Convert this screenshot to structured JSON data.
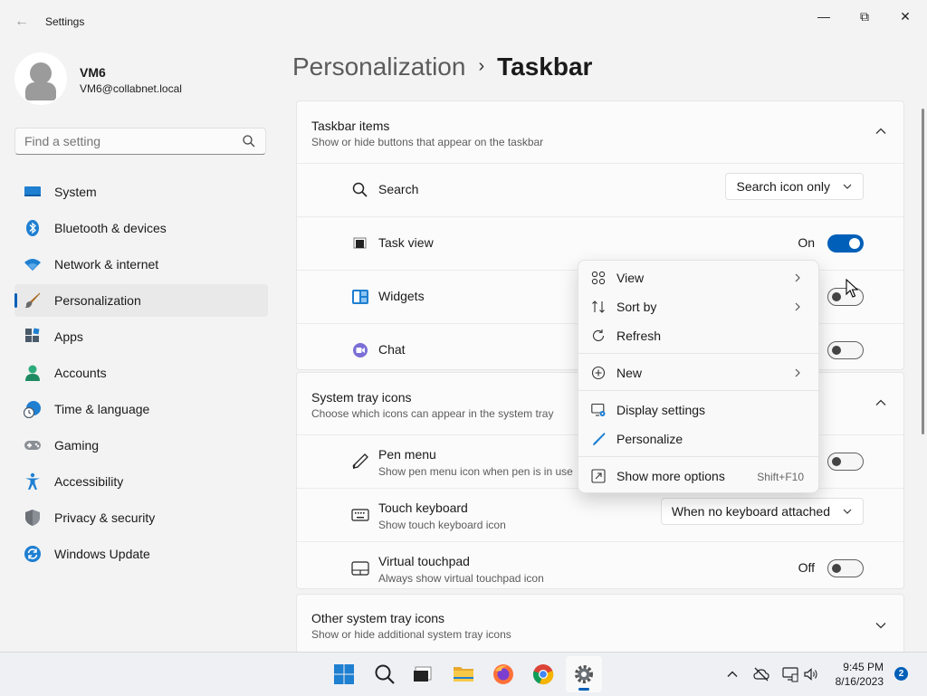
{
  "window": {
    "title": "Settings",
    "minimize_glyph": "—",
    "maximize_glyph": "⧉",
    "close_glyph": "✕",
    "back_glyph": "←"
  },
  "profile": {
    "name": "VM6",
    "email": "VM6@collabnet.local"
  },
  "search": {
    "placeholder": "Find a setting"
  },
  "nav": {
    "items": [
      {
        "label": "System",
        "icon": "monitor-icon"
      },
      {
        "label": "Bluetooth & devices",
        "icon": "bluetooth-icon"
      },
      {
        "label": "Network & internet",
        "icon": "wifi-icon"
      },
      {
        "label": "Personalization",
        "icon": "brush-icon",
        "active": true
      },
      {
        "label": "Apps",
        "icon": "apps-icon"
      },
      {
        "label": "Accounts",
        "icon": "person-icon"
      },
      {
        "label": "Time & language",
        "icon": "globe-clock-icon"
      },
      {
        "label": "Gaming",
        "icon": "gamepad-icon"
      },
      {
        "label": "Accessibility",
        "icon": "accessibility-icon"
      },
      {
        "label": "Privacy & security",
        "icon": "shield-icon"
      },
      {
        "label": "Windows Update",
        "icon": "update-icon"
      }
    ]
  },
  "breadcrumb": {
    "parent": "Personalization",
    "separator": "›",
    "current": "Taskbar"
  },
  "taskbar_items": {
    "title": "Taskbar items",
    "subtitle": "Show or hide buttons that appear on the taskbar",
    "rows": {
      "search": {
        "label": "Search",
        "value": "Search icon only"
      },
      "task_view": {
        "label": "Task view",
        "state": "On"
      },
      "widgets": {
        "label": "Widgets"
      },
      "chat": {
        "label": "Chat"
      }
    }
  },
  "system_tray": {
    "title": "System tray icons",
    "subtitle": "Choose which icons can appear in the system tray",
    "rows": {
      "pen_menu": {
        "label": "Pen menu",
        "sub": "Show pen menu icon when pen is in use"
      },
      "touch_keyboard": {
        "label": "Touch keyboard",
        "sub": "Show touch keyboard icon",
        "value": "When no keyboard attached"
      },
      "virtual_touchpad": {
        "label": "Virtual touchpad",
        "sub": "Always show virtual touchpad icon",
        "state": "Off"
      }
    }
  },
  "other_tray": {
    "title": "Other system tray icons",
    "subtitle": "Show or hide additional system tray icons"
  },
  "context_menu": {
    "view": "View",
    "sort_by": "Sort by",
    "refresh": "Refresh",
    "new": "New",
    "display_settings": "Display settings",
    "personalize": "Personalize",
    "show_more": "Show more options",
    "show_more_shortcut": "Shift+F10"
  },
  "taskbar": {
    "clock_time": "9:45 PM",
    "clock_date": "8/16/2023",
    "notification_count": "2"
  },
  "colors": {
    "accent": "#005fb8",
    "background": "#f3f3f3",
    "card": "#fbfbfb"
  }
}
